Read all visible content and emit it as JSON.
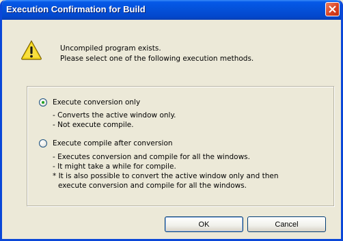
{
  "window": {
    "title": "Execution Confirmation for Build"
  },
  "message": {
    "line1": "Uncompiled program exists.",
    "line2": "Please select one of the following execution methods."
  },
  "options": [
    {
      "label": "Execute conversion only",
      "checked": true,
      "details": [
        "- Converts the active window only.",
        "- Not execute compile."
      ]
    },
    {
      "label": "Execute compile after conversion",
      "checked": false,
      "details": [
        "- Executes conversion and compile for all the windows.",
        "- It might take a while for compile.",
        "* It is also possible to convert the active window only and then",
        "execute conversion and compile for all the windows."
      ]
    }
  ],
  "buttons": {
    "ok": "OK",
    "cancel": "Cancel"
  },
  "icons": {
    "warning": "warning-icon",
    "close": "close-icon"
  },
  "colors": {
    "titlebar": "#0450d8",
    "close_button": "#d84020",
    "warning_fill": "#f5d71a"
  }
}
